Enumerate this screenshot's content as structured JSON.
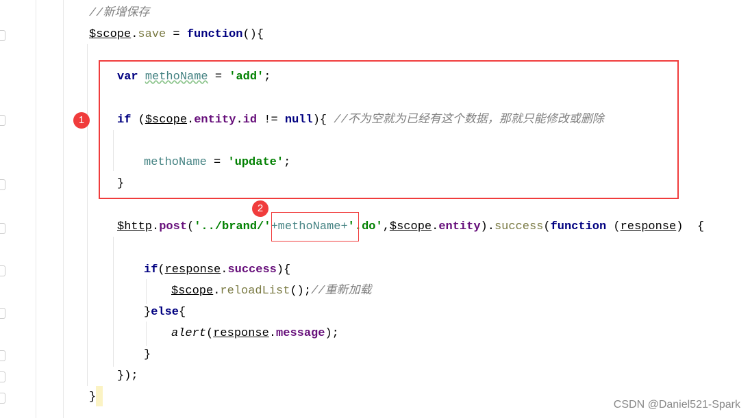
{
  "editor": {
    "lines": [
      {
        "tokens": [
          {
            "t": "//新增保存",
            "c": "cmt"
          }
        ]
      },
      {
        "tokens": [
          {
            "t": "$scope",
            "c": "ul"
          },
          {
            "t": ".",
            "c": ""
          },
          {
            "t": "save",
            "c": "fn"
          },
          {
            "t": " = ",
            "c": ""
          },
          {
            "t": "function",
            "c": "kw"
          },
          {
            "t": "(){",
            "c": ""
          }
        ]
      },
      {
        "tokens": [
          {
            "t": "var",
            "c": "kw"
          },
          {
            "t": " ",
            "c": ""
          },
          {
            "t": "methoName",
            "c": "var wavy"
          },
          {
            "t": " = ",
            "c": ""
          },
          {
            "t": "'add'",
            "c": "str"
          },
          {
            "t": ";",
            "c": ""
          }
        ]
      },
      {
        "tokens": [
          {
            "t": "if",
            "c": "kw"
          },
          {
            "t": " (",
            "c": ""
          },
          {
            "t": "$scope",
            "c": "ul"
          },
          {
            "t": ".",
            "c": ""
          },
          {
            "t": "entity",
            "c": "prop"
          },
          {
            "t": ".",
            "c": ""
          },
          {
            "t": "id",
            "c": "prop"
          },
          {
            "t": " != ",
            "c": ""
          },
          {
            "t": "null",
            "c": "kw"
          },
          {
            "t": "){ ",
            "c": ""
          },
          {
            "t": "//不为空就为已经有这个数据，那就只能修改或删除",
            "c": "cmt"
          }
        ]
      },
      {
        "tokens": [
          {
            "t": "methoName",
            "c": "var"
          },
          {
            "t": " = ",
            "c": ""
          },
          {
            "t": "'update'",
            "c": "str"
          },
          {
            "t": ";",
            "c": ""
          }
        ]
      },
      {
        "tokens": [
          {
            "t": "}",
            "c": ""
          }
        ]
      },
      {
        "tokens": [
          {
            "t": "$http",
            "c": "ul"
          },
          {
            "t": ".",
            "c": ""
          },
          {
            "t": "post",
            "c": "prop"
          },
          {
            "t": "(",
            "c": ""
          },
          {
            "t": "'../brand/'",
            "c": "str"
          },
          {
            "t": "+methoName+",
            "c": "var"
          },
          {
            "t": "'.do'",
            "c": "str"
          },
          {
            "t": ",",
            "c": ""
          },
          {
            "t": "$scope",
            "c": "ul"
          },
          {
            "t": ".",
            "c": ""
          },
          {
            "t": "entity",
            "c": "prop"
          },
          {
            "t": ").",
            "c": ""
          },
          {
            "t": "success",
            "c": "fn"
          },
          {
            "t": "(",
            "c": ""
          },
          {
            "t": "function",
            "c": "kw"
          },
          {
            "t": " (",
            "c": ""
          },
          {
            "t": "response",
            "c": "ul"
          },
          {
            "t": ")  {",
            "c": ""
          }
        ]
      },
      {
        "tokens": [
          {
            "t": "if",
            "c": "kw"
          },
          {
            "t": "(",
            "c": ""
          },
          {
            "t": "response",
            "c": "ul"
          },
          {
            "t": ".",
            "c": ""
          },
          {
            "t": "success",
            "c": "prop"
          },
          {
            "t": "){",
            "c": ""
          }
        ]
      },
      {
        "tokens": [
          {
            "t": "$scope",
            "c": "ul"
          },
          {
            "t": ".",
            "c": ""
          },
          {
            "t": "reloadList",
            "c": "fn"
          },
          {
            "t": "();",
            "c": ""
          },
          {
            "t": "//重新加载",
            "c": "cmt"
          }
        ]
      },
      {
        "tokens": [
          {
            "t": "}",
            "c": ""
          },
          {
            "t": "else",
            "c": "kw"
          },
          {
            "t": "{",
            "c": ""
          }
        ]
      },
      {
        "tokens": [
          {
            "t": "alert",
            "c": "it"
          },
          {
            "t": "(",
            "c": ""
          },
          {
            "t": "response",
            "c": "ul"
          },
          {
            "t": ".",
            "c": ""
          },
          {
            "t": "message",
            "c": "prop"
          },
          {
            "t": ");",
            "c": ""
          }
        ]
      },
      {
        "tokens": [
          {
            "t": "}",
            "c": ""
          }
        ]
      },
      {
        "tokens": [
          {
            "t": "});",
            "c": ""
          }
        ]
      },
      {
        "tokens": [
          {
            "t": "}",
            "c": ""
          }
        ]
      }
    ]
  },
  "annotations": {
    "badge1": "1",
    "badge2": "2",
    "box_color": "#f03c3c"
  },
  "watermark": "CSDN @Daniel521-Spark"
}
